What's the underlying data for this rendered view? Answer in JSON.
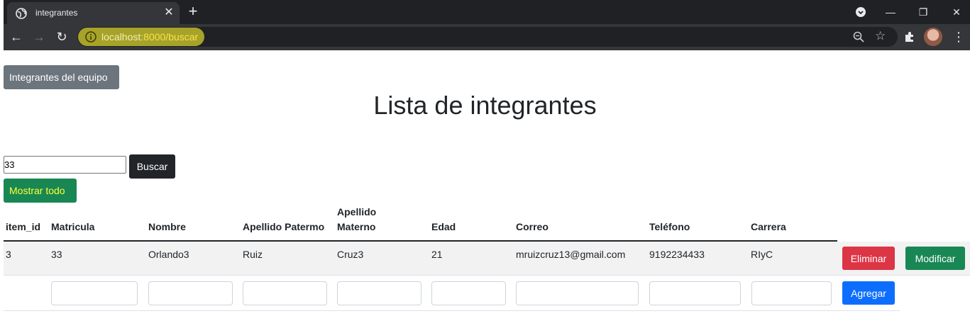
{
  "browser": {
    "tab_title": "integrantes",
    "url_host": "localhost",
    "url_rest": ":8000/buscar"
  },
  "page": {
    "team_button": "Integrantes del equipo",
    "title": "Lista de integrantes",
    "search_value": "33",
    "search_button": "Buscar",
    "show_all_button": "Mostrar todo"
  },
  "table": {
    "headers": [
      "item_id",
      "Matricula",
      "Nombre",
      "Apellido Patermo",
      "Apellido",
      "Materno",
      "Edad",
      "Correo",
      "Teléfono",
      "Carrera"
    ],
    "rows": [
      {
        "item_id": "3",
        "matricula": "33",
        "nombre": "Orlando3",
        "apellido_paterno": "Ruiz",
        "apellido_materno": "Cruz3",
        "edad": "21",
        "correo": "mruizcruz13@gmail.com",
        "telefono": "9192234433",
        "carrera": "RIyC"
      }
    ],
    "delete_button": "Eliminar",
    "modify_button": "Modificar",
    "add_button": "Agregar"
  },
  "colors": {
    "primary": "#0d6efd",
    "success": "#198754",
    "danger": "#dc3545",
    "secondary": "#6c757d",
    "dark": "#212529"
  }
}
